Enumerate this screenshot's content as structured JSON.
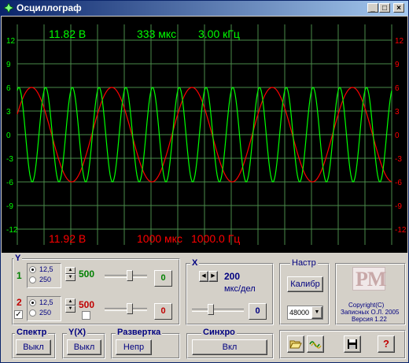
{
  "window": {
    "title": "Осциллограф",
    "minimize": "_",
    "maximize": "□",
    "close": "×"
  },
  "scope": {
    "ch1_readout": "11.82 В",
    "ch2_readout": "11.92 В",
    "time_readout": "333 мкс",
    "freq_readout": "3.00 кГц",
    "time2_readout": "1000 мкс",
    "freq2_readout": "1000.0 Гц",
    "y_ticks_left": [
      "12",
      "9",
      "6",
      "3",
      "0",
      "-3",
      "-6",
      "-9",
      "-12"
    ],
    "y_ticks_right": [
      "12",
      "9",
      "6",
      "3",
      "0",
      "-3",
      "-6",
      "-9",
      "-12"
    ],
    "ch1_color": "#00ff00",
    "ch2_color": "#ff0000",
    "grid_color": "#4a8a4a",
    "ch1_amplitude": 6,
    "ch2_amplitude": 6,
    "ch1_period_divs": 1.0,
    "ch2_period_divs": 3.0
  },
  "y_panel": {
    "label": "Y",
    "ch1": {
      "num": "1",
      "opt_a": "12,5",
      "opt_b": "250",
      "value": "500",
      "offset": "0",
      "color": "#008000"
    },
    "ch2": {
      "num": "2",
      "opt_a": "12,5",
      "opt_b": "250",
      "value": "500",
      "offset": "0",
      "color": "#c00000"
    }
  },
  "x_panel": {
    "label": "X",
    "value": "200",
    "unit": "мкс/дел",
    "offset": "0"
  },
  "setup_panel": {
    "label": "Настр",
    "calib": "Калибр",
    "rate": "48000"
  },
  "logo": {
    "text": "PM",
    "copyright": "Copyright(C)",
    "author": "Записных О.Л. 2005",
    "version": "Версия 1.22"
  },
  "bottom": {
    "spectrum": {
      "label": "Спектр",
      "button": "Выкл"
    },
    "yx": {
      "label": "Y(X)",
      "button": "Выкл"
    },
    "sweep": {
      "label": "Развертка",
      "button": "Непр"
    },
    "sync": {
      "label": "Синхро",
      "button": "Вкл"
    },
    "help": "?"
  }
}
